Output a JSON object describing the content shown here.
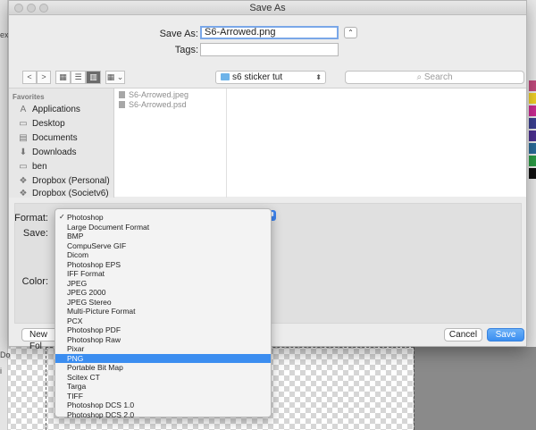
{
  "background": {
    "left_texts": [
      "ext",
      "Do",
      "i"
    ],
    "swatches": [
      "#c24a7d",
      "#f0d028",
      "#cc2b93",
      "#3b3f91",
      "#4b2f90",
      "#2a6b9a",
      "#2b9b45",
      "#111111"
    ]
  },
  "dialog": {
    "title": "Save As",
    "save_as_label": "Save As:",
    "save_as_value": "S6-Arrowed.png",
    "tags_label": "Tags:",
    "tags_value": ""
  },
  "toolbar": {
    "back": "<",
    "forward": ">",
    "view_icons": "▦",
    "view_list": "☰",
    "view_columns": "▥",
    "view_gallery": "▦ ⌄",
    "location": "s6 sticker tut",
    "search_placeholder": "Search"
  },
  "sidebar": {
    "heading": "Favorites",
    "items": [
      {
        "label": "Applications",
        "icon": "A"
      },
      {
        "label": "Desktop",
        "icon": "▭"
      },
      {
        "label": "Documents",
        "icon": "▤"
      },
      {
        "label": "Downloads",
        "icon": "⬇"
      },
      {
        "label": "ben",
        "icon": "▭"
      },
      {
        "label": "Dropbox (Personal)",
        "icon": "❖"
      },
      {
        "label": "Dropbox (Societv6)",
        "icon": "❖"
      }
    ]
  },
  "files": [
    "S6-Arrowed.jpeg",
    "S6-Arrowed.psd"
  ],
  "options": {
    "format_label": "Format:",
    "save_label": "Save:",
    "color_label": "Color:"
  },
  "buttons": {
    "new_folder": "New Fol",
    "cancel": "Cancel",
    "save": "Save"
  },
  "format_menu": {
    "items": [
      "Photoshop",
      "Large Document Format",
      "BMP",
      "CompuServe GIF",
      "Dicom",
      "Photoshop EPS",
      "IFF Format",
      "JPEG",
      "JPEG 2000",
      "JPEG Stereo",
      "Multi-Picture Format",
      "PCX",
      "Photoshop PDF",
      "Photoshop Raw",
      "Pixar",
      "PNG",
      "Portable Bit Map",
      "Scitex CT",
      "Targa",
      "TIFF",
      "Photoshop DCS 1.0",
      "Photoshop DCS 2.0"
    ],
    "checked": "Photoshop",
    "highlighted": "PNG"
  }
}
